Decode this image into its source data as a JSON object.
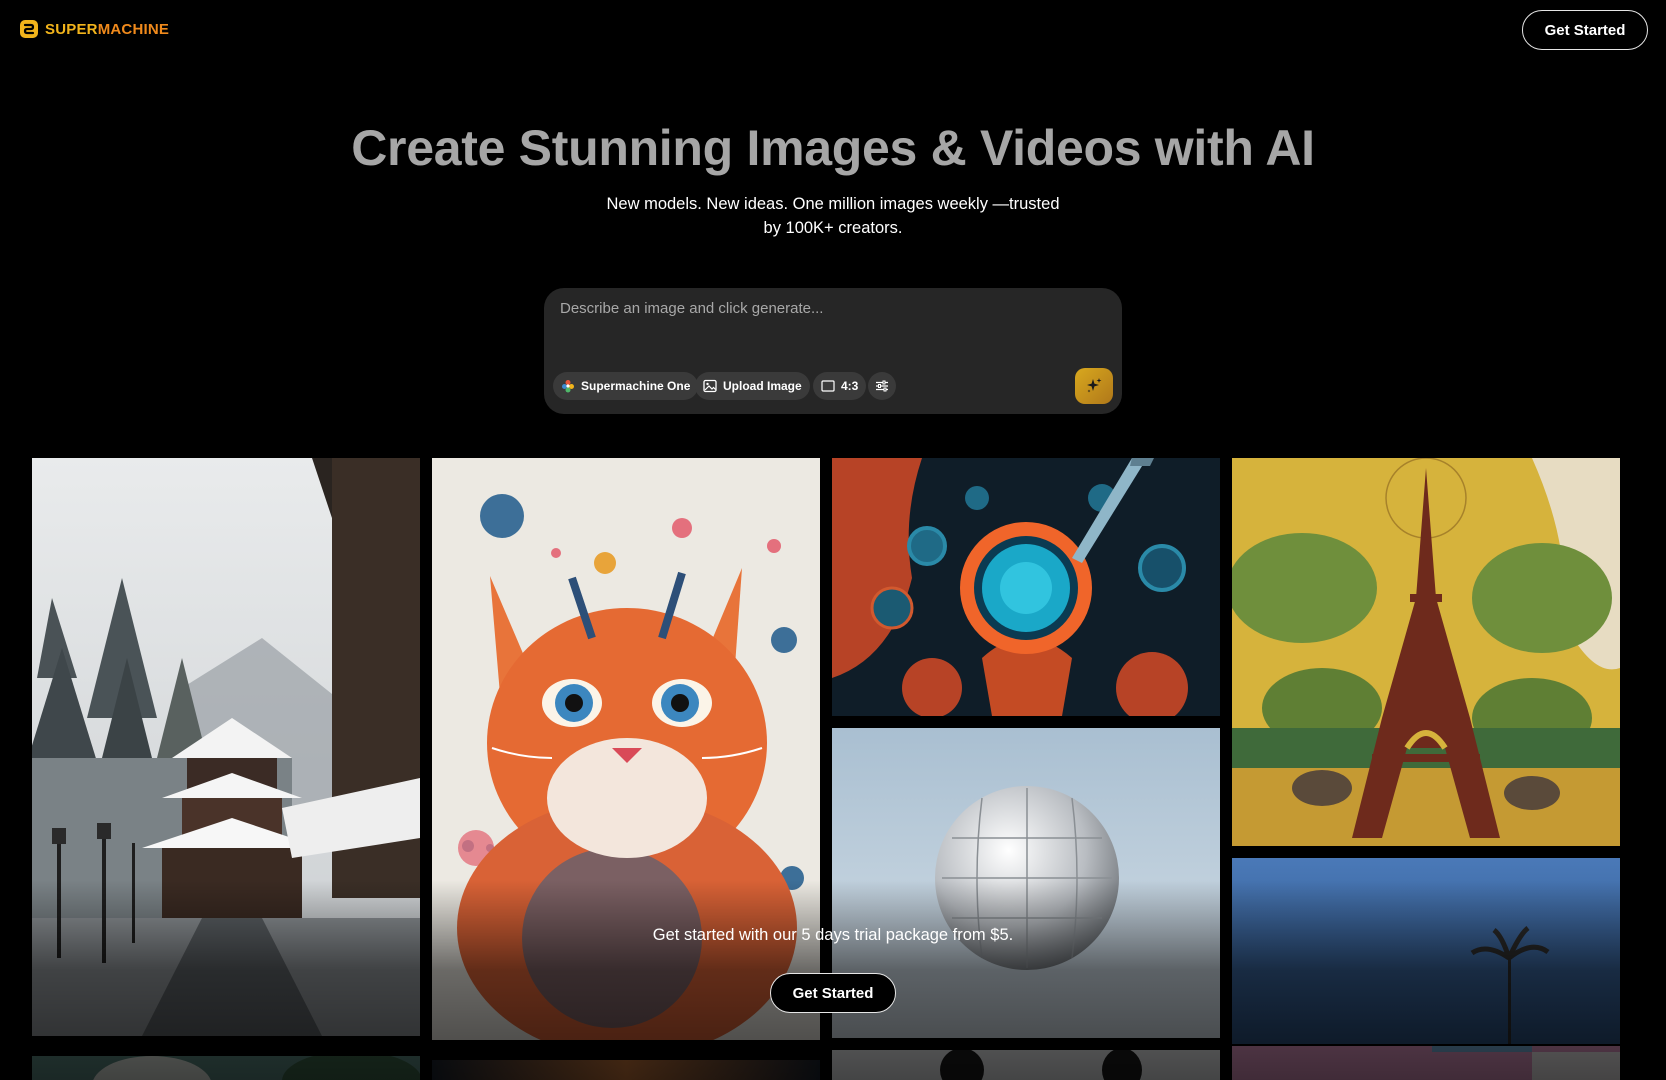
{
  "brand": {
    "name_part1": "SUPER",
    "name_part2": "MACHINE",
    "colors": {
      "primary": "#f2b41b",
      "secondary": "#f08a1c"
    }
  },
  "header": {
    "cta_label": "Get Started"
  },
  "hero": {
    "title": "Create Stunning Images & Videos with AI",
    "subtitle": "New models. New ideas. One million images weekly —trusted by 100K+ creators."
  },
  "prompt": {
    "placeholder": "Describe an image and click generate...",
    "model_label": "Supermachine One",
    "upload_label": "Upload Image",
    "ratio_label": "4:3",
    "settings_icon": "sliders-icon",
    "generate_icon": "sparkle-icon"
  },
  "gallery": {
    "images": [
      {
        "name": "snowy-temple-image"
      },
      {
        "name": "watercolor-cat-image"
      },
      {
        "name": "glowing-cell-image"
      },
      {
        "name": "eiffel-tower-art-image"
      },
      {
        "name": "disco-ball-sky-image"
      },
      {
        "name": "palm-tree-sky-image"
      },
      {
        "name": "white-flower-image"
      },
      {
        "name": "orange-blur-image"
      },
      {
        "name": "snowboarders-image"
      },
      {
        "name": "pink-building-image"
      }
    ]
  },
  "trial": {
    "text": "Get started with our 5 days trial package from $5.",
    "cta_label": "Get Started"
  }
}
